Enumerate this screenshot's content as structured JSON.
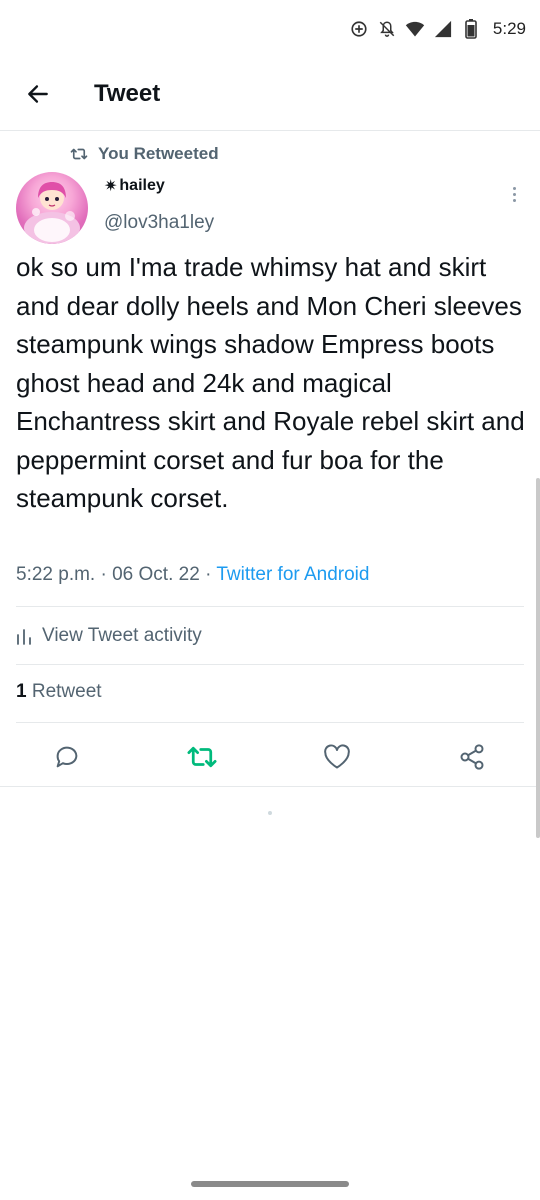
{
  "status_bar": {
    "time": "5:29",
    "icons": [
      "data-saver-icon",
      "notifications-off-icon",
      "wifi-icon",
      "signal-icon",
      "battery-icon"
    ]
  },
  "app_bar": {
    "title": "Tweet",
    "back_icon": "back-arrow-icon"
  },
  "tweet": {
    "retweet_label": "You Retweeted",
    "author": {
      "display_name": "hailey",
      "name_prefix_glyph": "✷",
      "handle": "@lov3ha1ley"
    },
    "text": "ok so um I'ma trade whimsy hat and skirt and dear dolly heels and Mon Cheri sleeves steampunk wings shadow Empress boots ghost head and 24k and magical Enchantress skirt and Royale rebel skirt and peppermint corset and fur boa for the steampunk corset.",
    "time": "5:22 p.m.",
    "date": "06 Oct. 22",
    "source": "Twitter for Android",
    "separator": "·",
    "activity_label": "View Tweet activity",
    "retweet_count": "1",
    "retweet_count_label": "Retweet"
  },
  "actions": {
    "reply_icon": "reply-icon",
    "retweet_icon": "retweet-icon",
    "like_icon": "heart-icon",
    "share_icon": "share-icon"
  },
  "colors": {
    "accent_blue": "#1d9bf0",
    "retweet_green": "#00ba7c",
    "secondary_text": "#536471"
  }
}
